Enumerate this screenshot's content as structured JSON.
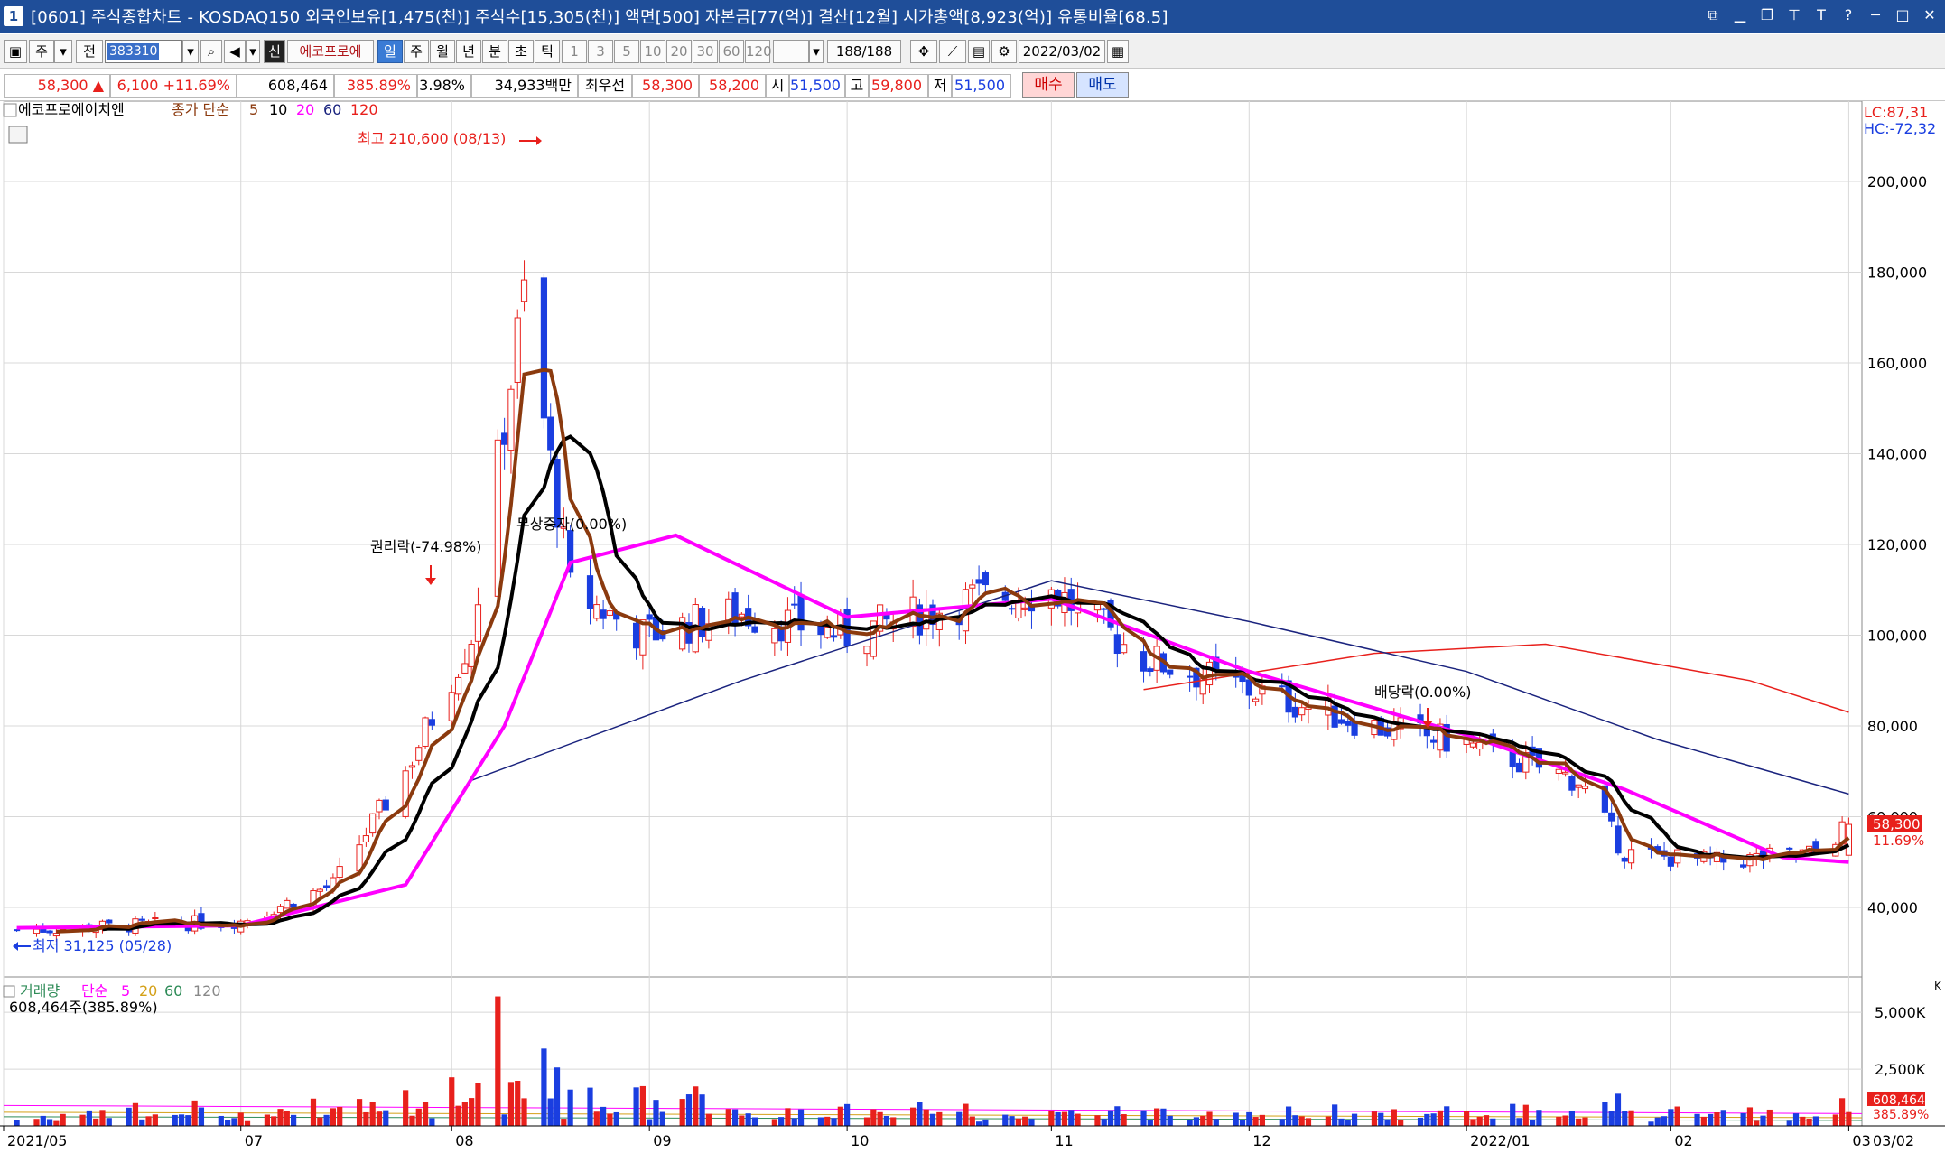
{
  "window": {
    "icon_label": "1",
    "title": "[0601] 주식종합차트 - KOSDAQ150 외국인보유[1,475(천)] 주식수[15,305(천)] 액면[500] 자본금[77(억)] 결산[12월] 시가총액[8,923(억)] 유통비율[68.5]"
  },
  "toolbar": {
    "period_mode": "주",
    "prev_label": "전",
    "stock_code": "383310",
    "stock_type_badge": "신",
    "stock_name": "에코프로에",
    "period_tabs": [
      "일",
      "주",
      "월",
      "년",
      "분",
      "초",
      "틱"
    ],
    "active_period": "일",
    "interval_buttons": [
      "1",
      "3",
      "5",
      "10",
      "20",
      "30",
      "60",
      "120"
    ],
    "count_display": "188/188",
    "date_value": "2022/03/02"
  },
  "quote": {
    "price": "58,300",
    "arrow": "▲",
    "change": "6,100",
    "change_pct": "+11.69%",
    "volume": "608,464",
    "volume_ratio": "385.89%",
    "turnover": "3.98%",
    "amount": "34,933백만",
    "best_label": "최우선",
    "best_ask": "58,300",
    "best_bid": "58,200",
    "open_label": "시",
    "open": "51,500",
    "high_label": "고",
    "high": "59,800",
    "low_label": "저",
    "low": "51,500",
    "buy_label": "매수",
    "sell_label": "매도"
  },
  "price_panel": {
    "legend_name": "에코프로에이치엔",
    "legend_ma_label": "종가 단순",
    "legend_periods": [
      "5",
      "10",
      "20",
      "60",
      "120"
    ],
    "lc_label": "LC:87,31",
    "hc_label": "HC:-72,32",
    "y_ticks": [
      "40,000",
      "60,000",
      "80,000",
      "100,000",
      "120,000",
      "140,000",
      "160,000",
      "180,000",
      "200,000"
    ],
    "last_price_tag": "58,300",
    "last_pct_tag": "11.69%",
    "annot_high": "최고 210,600 (08/13)",
    "annot_low": "최저 31,125 (05/28)",
    "annot_rights": "권리락(-74.98%)",
    "annot_bonus": "무상증자(0.00%)",
    "annot_dividend": "배당락(0.00%)"
  },
  "volume_panel": {
    "legend_name": "거래량",
    "legend_ma_label": "단순",
    "legend_periods": [
      "5",
      "20",
      "60",
      "120"
    ],
    "value_label": "608,464주(385.89%)",
    "y_ticks": [
      "5,000K",
      "2,500K"
    ],
    "corner_label": "K",
    "last_volume_tag": "608,464",
    "last_ratio_tag": "385.89%"
  },
  "x_axis": {
    "labels": [
      "2021/05",
      "07",
      "08",
      "09",
      "10",
      "11",
      "12",
      "2022/01",
      "02",
      "03",
      "03/02"
    ]
  },
  "colors": {
    "up": "#e8201c",
    "down": "#1a3ee0",
    "ma5": "#8b3a0e",
    "ma10": "#000000",
    "ma20": "#ff00ff",
    "ma60": "#1a237e",
    "ma120": "#e8201c",
    "titlebar": "#1f4e99"
  },
  "chart_data": {
    "type": "candlestick",
    "y_range": [
      25000,
      215000
    ],
    "volume_range_k": [
      0,
      6000
    ],
    "series": [
      {
        "name": "종가",
        "x": [
          "2021/05/28",
          "2021/06/15",
          "2021/07/01",
          "2021/07/15",
          "2021/07/26",
          "2021/08/05",
          "2021/08/13",
          "2021/08/20",
          "2021/08/31",
          "2021/09/15",
          "2021/10/01",
          "2021/10/20",
          "2021/11/01",
          "2021/11/15",
          "2021/12/01",
          "2021/12/20",
          "2022/01/03",
          "2022/01/20",
          "2022/01/27",
          "2022/02/10",
          "2022/02/25",
          "2022/03/02"
        ],
        "values": [
          35000,
          36000,
          37000,
          45000,
          70000,
          100000,
          175000,
          110000,
          100000,
          105000,
          100000,
          108000,
          110000,
          95000,
          88000,
          80000,
          76000,
          68000,
          52000,
          50000,
          52000,
          58300
        ]
      },
      {
        "name": "20",
        "x": [
          "2021/05/28",
          "2021/07/01",
          "2021/07/26",
          "2021/08/10",
          "2021/08/20",
          "2021/09/05",
          "2021/10/01",
          "2021/11/01",
          "2021/12/01",
          "2022/01/03",
          "2022/01/27",
          "2022/02/20",
          "2022/03/02"
        ],
        "values": [
          35500,
          36000,
          45000,
          80000,
          116000,
          122000,
          104000,
          108000,
          92000,
          78000,
          66000,
          51000,
          50000
        ]
      },
      {
        "name": "60",
        "x": [
          "2021/08/05",
          "2021/09/15",
          "2021/11/01",
          "2021/12/01",
          "2022/01/03",
          "2022/02/01",
          "2022/03/02"
        ],
        "values": [
          68000,
          90000,
          112000,
          103000,
          92000,
          77000,
          65000
        ]
      },
      {
        "name": "120",
        "x": [
          "2021/11/15",
          "2021/12/20",
          "2022/01/15",
          "2022/02/15",
          "2022/03/02"
        ],
        "values": [
          88000,
          96000,
          98000,
          90000,
          83000
        ]
      }
    ]
  }
}
